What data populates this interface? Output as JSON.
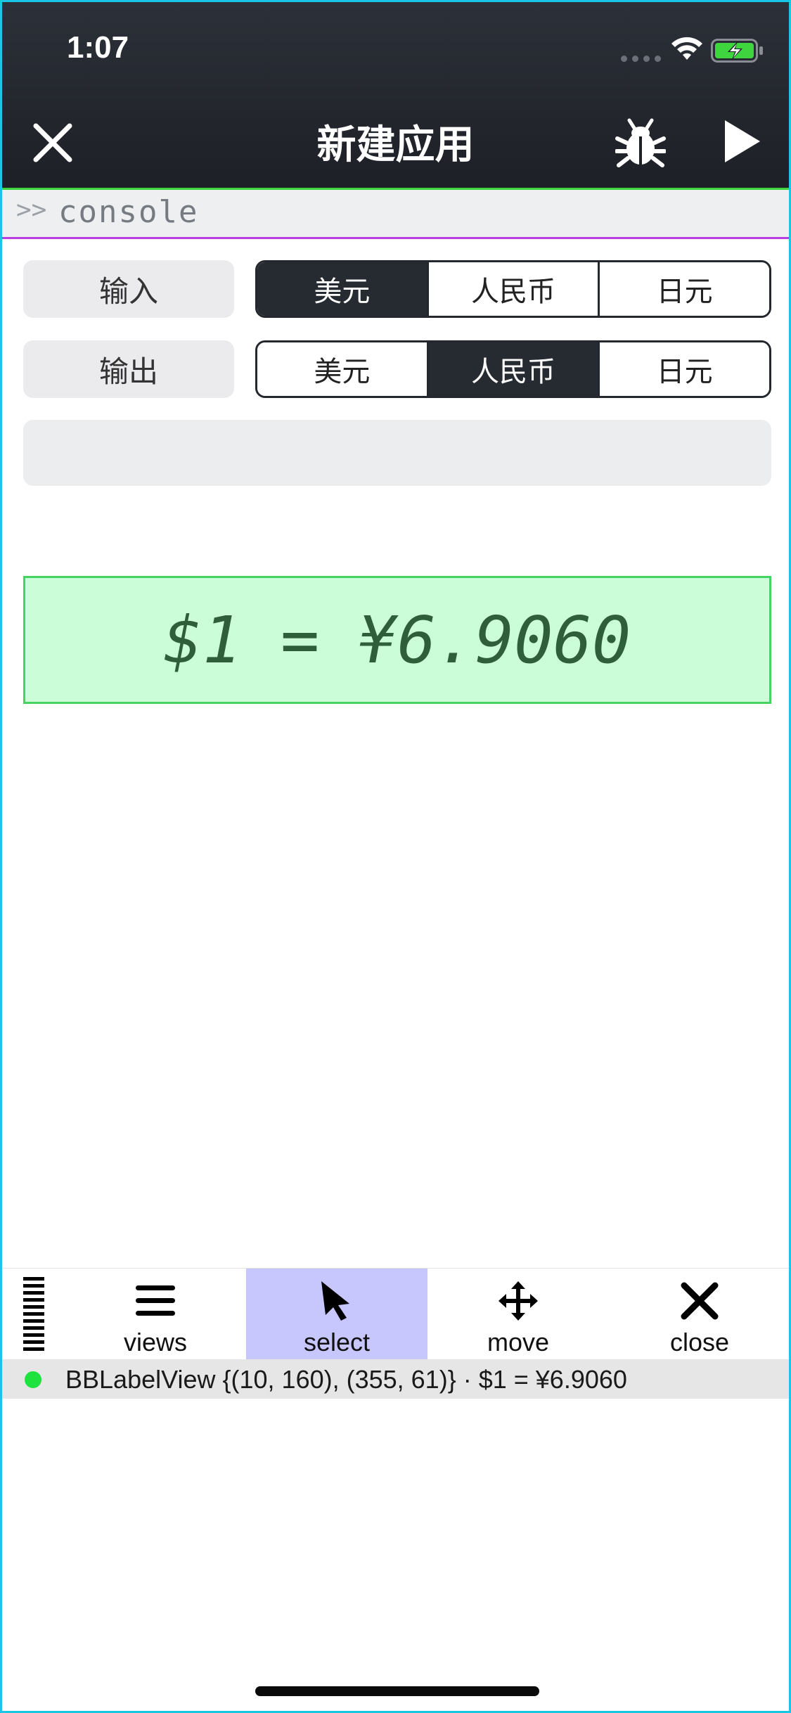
{
  "status_bar": {
    "time": "1:07"
  },
  "nav": {
    "title": "新建应用",
    "left_icon": "close-icon",
    "right_icons": [
      "bug-icon",
      "play-icon"
    ]
  },
  "console": {
    "prompt": ">>",
    "text": "console"
  },
  "input_row": {
    "label": "输入",
    "options": [
      "美元",
      "人民币",
      "日元"
    ],
    "selected": "美元"
  },
  "output_row": {
    "label": "输出",
    "options": [
      "美元",
      "人民币",
      "日元"
    ],
    "selected": "人民币"
  },
  "amount_field": {
    "value": "",
    "placeholder": ""
  },
  "result": {
    "text": "$1 = ¥6.9060"
  },
  "toolbar": {
    "items": [
      {
        "label": "views",
        "icon": "hamburger-icon"
      },
      {
        "label": "select",
        "icon": "cursor-icon"
      },
      {
        "label": "move",
        "icon": "move-arrows-icon"
      },
      {
        "label": "close",
        "icon": "close-icon"
      }
    ],
    "active": "select"
  },
  "info_bar": {
    "text": "BBLabelView {(10, 160), (355, 61)} · $1 = ¥6.9060",
    "status_color": "#1fe23e"
  },
  "colors": {
    "header_bg": "#1d2026",
    "accent_green": "#3fd53f",
    "console_border": "#b93fe0",
    "result_bg": "#ccfdd9",
    "result_border": "#44d464",
    "active_tool_bg": "#c7c7fd"
  }
}
